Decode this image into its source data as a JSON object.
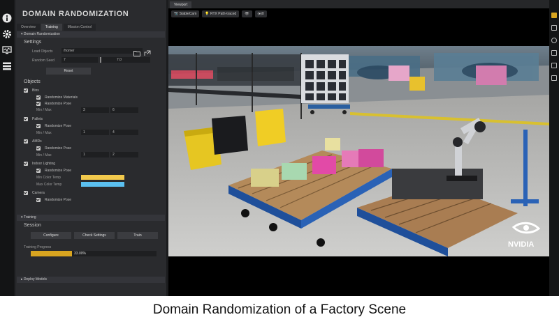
{
  "panel": {
    "title": "DOMAIN RANDOMIZATION",
    "tabs": [
      "Overview",
      "Training",
      "Mission Control"
    ],
    "section_dr": "Domain Randomization",
    "settings": {
      "heading": "Settings",
      "load_objects_label": "Load Objects",
      "load_objects_value": "/home/",
      "random_seed_label": "Random Seed",
      "random_seed_value": "7",
      "random_seed_slider": "7.0",
      "reset_label": "Reset"
    },
    "objects": {
      "heading": "Objects",
      "bins_label": "Bins",
      "bins_rand_materials": "Randomize Materials",
      "bins_rand_pose": "Randomize Pose",
      "bins_minmax_label": "Min / Max",
      "bins_min": "3",
      "bins_max": "6",
      "pallets_label": "Pallets",
      "pallets_rand_pose": "Randomize Pose",
      "pallets_minmax_label": "Min / Max",
      "pallets_min": "1",
      "pallets_max": "4",
      "amrs_label": "AMRs",
      "amrs_rand_pose": "Randomize Pose",
      "amrs_minmax_label": "Min / Max",
      "amrs_min": "1",
      "amrs_max": "2",
      "lighting_label": "Indoor Lighting",
      "lighting_rand_pose": "Randomize Pose",
      "min_color_temp_label": "Min Color Temp",
      "max_color_temp_label": "Max Color Temp",
      "camera_label": "Camera",
      "camera_rand_pose": "Randomize Pose"
    },
    "training": {
      "section": "Training",
      "heading": "Session",
      "configure_label": "Configure",
      "check_settings_label": "Check Settings",
      "train_label": "Train",
      "progress_label": "Training Progress",
      "progress_value": 0.33,
      "progress_text": "33.00%"
    },
    "deploy_section": "Deploy Models"
  },
  "viewport": {
    "tab": "Viewport",
    "toolbar": [
      "StableCam",
      "RTX Path-traced",
      "(●)0"
    ]
  },
  "caption": "Domain Randomization of a Factory Scene",
  "colors": {
    "min_color_temp": "#f2c94c",
    "max_color_temp": "#5bc0f0",
    "progress": "#d9a520"
  },
  "brand": "NVIDIA"
}
